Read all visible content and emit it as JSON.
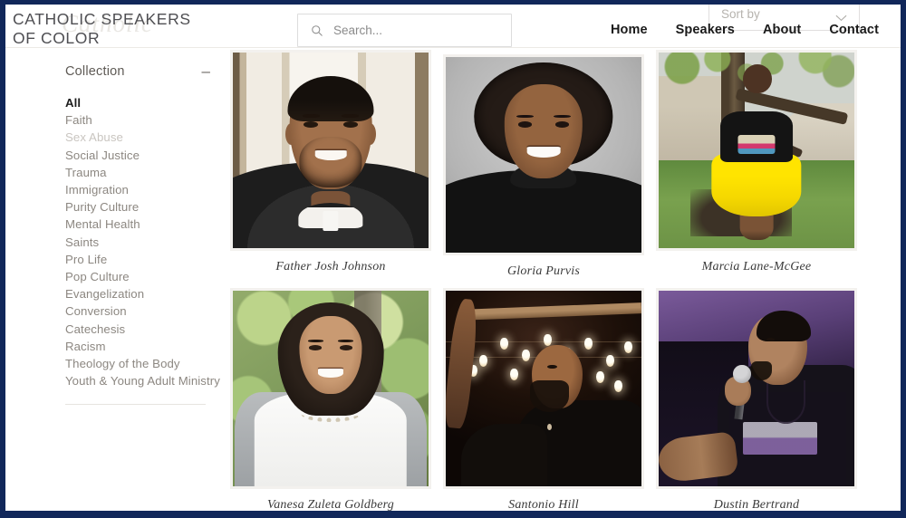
{
  "header": {
    "logo_line1": "CATHOLIC SPEAKERS",
    "logo_line2": "OF COLOR",
    "logo_text": "CATHOLIC SPEAKERS\nOF COLOR",
    "watermark_text": "Catholic",
    "search": {
      "placeholder": "Search...",
      "value": "",
      "icon": "search-icon"
    },
    "sort": {
      "label": "Sort by",
      "chevron_icon": "chevron-down-icon"
    },
    "nav": [
      {
        "label": "Home"
      },
      {
        "label": "Speakers"
      },
      {
        "label": "About"
      },
      {
        "label": "Contact"
      }
    ]
  },
  "sidebar": {
    "title": "Collection",
    "toggle_icon": "minus-icon",
    "toggle_glyph": "–",
    "items": [
      {
        "label": "All",
        "state": "active"
      },
      {
        "label": "Faith",
        "state": "normal"
      },
      {
        "label": "Sex Abuse",
        "state": "muted"
      },
      {
        "label": "Social Justice",
        "state": "normal"
      },
      {
        "label": "Trauma",
        "state": "normal"
      },
      {
        "label": "Immigration",
        "state": "normal"
      },
      {
        "label": "Purity Culture",
        "state": "normal"
      },
      {
        "label": "Mental Health",
        "state": "normal"
      },
      {
        "label": "Saints",
        "state": "normal"
      },
      {
        "label": "Pro Life",
        "state": "normal"
      },
      {
        "label": "Pop Culture",
        "state": "normal"
      },
      {
        "label": "Evangelization",
        "state": "normal"
      },
      {
        "label": "Conversion",
        "state": "normal"
      },
      {
        "label": "Catechesis",
        "state": "normal"
      },
      {
        "label": "Racism",
        "state": "normal"
      },
      {
        "label": "Theology of the Body",
        "state": "normal"
      },
      {
        "label": "Youth & Young Adult Ministry",
        "state": "normal"
      }
    ]
  },
  "gallery": {
    "speakers": [
      {
        "name": "Father Josh Johnson",
        "scene": "priest-portrait"
      },
      {
        "name": "Gloria Purvis",
        "scene": "studio-portrait"
      },
      {
        "name": "Marcia Lane-McGee",
        "scene": "outdoor-yellow-skirt"
      },
      {
        "name": "Vanesa Zuleta Goldberg",
        "scene": "foliage-portrait"
      },
      {
        "name": "Santonio Hill",
        "scene": "string-lights-night"
      },
      {
        "name": "Dustin Bertrand",
        "scene": "stage-microphone"
      }
    ]
  },
  "colors": {
    "page_border": "#11275a",
    "accent_navy": "#11275a",
    "nav_text": "#1a1a1a",
    "sidebar_text": "#8c8781",
    "sidebar_active": "#1d1d1d",
    "sidebar_muted": "#c9c5c0",
    "caption_text": "#3a3a3a",
    "frame": "#f3f1ee",
    "placeholder": "#8b8b8b"
  }
}
